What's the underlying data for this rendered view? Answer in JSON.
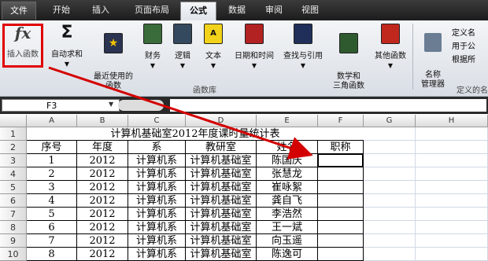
{
  "tabs": [
    {
      "label": "文件"
    },
    {
      "label": "开始"
    },
    {
      "label": "插入"
    },
    {
      "label": "页面布局"
    },
    {
      "label": "公式"
    },
    {
      "label": "数据"
    },
    {
      "label": "审阅"
    },
    {
      "label": "视图"
    }
  ],
  "ribbon": {
    "insert_function": "插入函数",
    "autosum": "自动求和",
    "recent": "最近使用的\n函数",
    "financial": "财务",
    "logical": "逻辑",
    "text": "文本",
    "datetime": "日期和时间",
    "lookup": "查找与引用",
    "math": "数学和\n三角函数",
    "more": "其他函数",
    "name_manager": "名称\n管理器",
    "define_name": "定义名",
    "use_in_formula": "用于公",
    "create_from_selection": "根据所",
    "group_library": "函数库",
    "group_defined": "定义的名"
  },
  "formula_bar": {
    "name_box": "F3",
    "fx_label": "fx"
  },
  "sheet": {
    "columns": [
      "A",
      "B",
      "C",
      "D",
      "E",
      "F",
      "G",
      "H"
    ],
    "rows": [
      "1",
      "2",
      "3",
      "4",
      "5",
      "6",
      "7",
      "8",
      "9",
      "10"
    ],
    "title": "计算机基础室2012年度课时量统计表",
    "headers": [
      "序号",
      "年度",
      "系",
      "教研室",
      "姓名",
      "职称"
    ],
    "data": [
      [
        "1",
        "2012",
        "计算机系",
        "计算机基础室",
        "陈国庆",
        ""
      ],
      [
        "2",
        "2012",
        "计算机系",
        "计算机基础室",
        "张慧龙",
        ""
      ],
      [
        "3",
        "2012",
        "计算机系",
        "计算机基础室",
        "崔咏絮",
        ""
      ],
      [
        "4",
        "2012",
        "计算机系",
        "计算机基础室",
        "龚自飞",
        ""
      ],
      [
        "5",
        "2012",
        "计算机系",
        "计算机基础室",
        "李浩然",
        ""
      ],
      [
        "6",
        "2012",
        "计算机系",
        "计算机基础室",
        "王一斌",
        ""
      ],
      [
        "7",
        "2012",
        "计算机系",
        "计算机基础室",
        "向玉遥",
        ""
      ],
      [
        "8",
        "2012",
        "计算机系",
        "计算机基础室",
        "陈逸可",
        ""
      ]
    ]
  },
  "colors": {
    "annotation_red": "#d40000",
    "highlight_border": "#e00000"
  }
}
